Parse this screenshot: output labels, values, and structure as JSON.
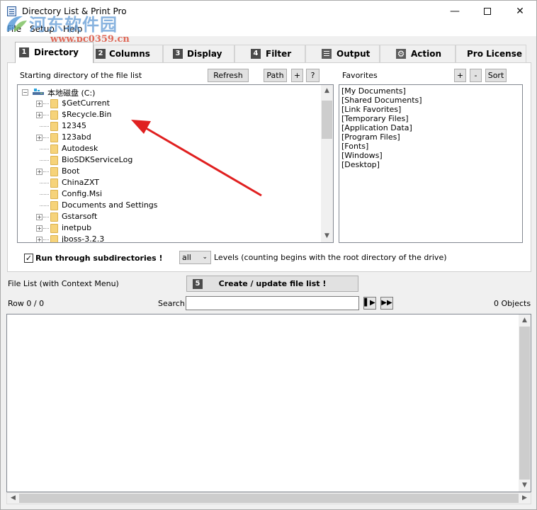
{
  "window": {
    "title": "Directory List & Print Pro"
  },
  "watermark": {
    "text1": "河东软件园",
    "text2": "www.pc0359.cn"
  },
  "menu": [
    "File",
    "Setup",
    "Help"
  ],
  "tabs": [
    {
      "num": "1",
      "label": "Directory",
      "active": true
    },
    {
      "num": "2",
      "label": "Columns"
    },
    {
      "num": "3",
      "label": "Display"
    },
    {
      "num": "4",
      "label": "Filter"
    },
    {
      "icon": "document-icon",
      "label": "Output"
    },
    {
      "icon": "gear-icon",
      "label": "Action"
    },
    {
      "label": "Pro License"
    }
  ],
  "directory": {
    "start_label": "Starting directory of the file list",
    "refresh": "Refresh",
    "path": "Path",
    "plus": "+",
    "help": "?",
    "root": "本地磁盘 (C:)",
    "items": [
      {
        "name": "$GetCurrent",
        "expandable": true
      },
      {
        "name": "$Recycle.Bin",
        "expandable": true
      },
      {
        "name": "12345",
        "expandable": false
      },
      {
        "name": "123abd",
        "expandable": true
      },
      {
        "name": "Autodesk",
        "expandable": false
      },
      {
        "name": "BioSDKServiceLog",
        "expandable": false
      },
      {
        "name": "Boot",
        "expandable": true
      },
      {
        "name": "ChinaZXT",
        "expandable": false
      },
      {
        "name": "Config.Msi",
        "expandable": false
      },
      {
        "name": "Documents and Settings",
        "expandable": false
      },
      {
        "name": "Gstarsoft",
        "expandable": true
      },
      {
        "name": "inetpub",
        "expandable": true
      },
      {
        "name": "jboss-3.2.3",
        "expandable": true
      }
    ]
  },
  "favorites": {
    "label": "Favorites",
    "plus": "+",
    "minus": "-",
    "sort": "Sort",
    "items": [
      "[My Documents]",
      "[Shared Documents]",
      "[Link Favorites]",
      "[Temporary Files]",
      "[Application Data]",
      "[Program Files]",
      "[Fonts]",
      "[Windows]",
      "[Desktop]"
    ]
  },
  "options": {
    "subdirs_label": "Run through subdirectories !",
    "subdirs_checked": true,
    "levels_value": "all",
    "levels_label": "Levels  (counting begins with the root directory of the drive)"
  },
  "filelist": {
    "label": "File List (with Context Menu)",
    "create_num": "5",
    "create_label": "Create / update file list !",
    "row_label": "Row 0 / 0",
    "search_label": "Search",
    "search_value": "",
    "objects": "0 Objects"
  }
}
